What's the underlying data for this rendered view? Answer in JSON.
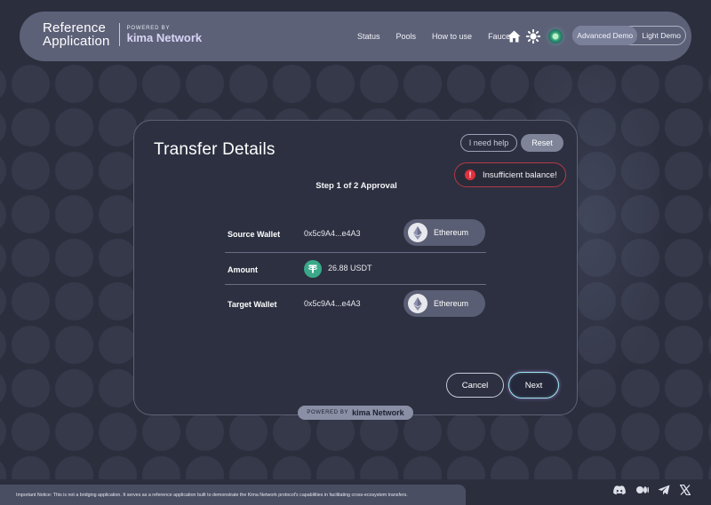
{
  "header": {
    "brand_title_line1": "Reference",
    "brand_title_line2": "Application",
    "powered_by": "POWERED BY",
    "kima": "kima Network",
    "nav": [
      "Status",
      "Pools",
      "How to use",
      "Faucet"
    ],
    "theme_toggle": {
      "active": "Advanced Demo",
      "inactive": "Light Demo"
    }
  },
  "card": {
    "title": "Transfer Details",
    "help_label": "I need help",
    "reset_label": "Reset",
    "error_message": "Insufficient balance!",
    "error_icon_glyph": "!",
    "step": "Step 1 of 2 Approval",
    "rows": {
      "source_label": "Source Wallet",
      "source_address": "0x5c9A4...e4A3",
      "source_chain": "Ethereum",
      "amount_label": "Amount",
      "amount_value": "26.88 USDT",
      "target_label": "Target Wallet",
      "target_address": "0x5c9A4...e4A3",
      "target_chain": "Ethereum"
    },
    "cancel_label": "Cancel",
    "next_label": "Next"
  },
  "powered_badge": {
    "prefix": "POWERED BY",
    "name": "kima Network"
  },
  "notice": "Important Notice: This is not a bridging application. It serves as a reference application built to demonstrate the Kima Network protocol's capabilities in facilitating cross-ecosystem transfers.",
  "icons": {
    "home": "home-icon",
    "sun": "sun-icon",
    "wallet": "wallet-icon",
    "discord": "discord-icon",
    "medium": "medium-icon",
    "telegram": "telegram-icon",
    "x": "x-icon",
    "ethereum": "ethereum-icon",
    "usdt": "usdt-icon"
  },
  "colors": {
    "error": "#e0303d",
    "next_glow": "#9fe6ec",
    "usdt": "#3aa889"
  }
}
